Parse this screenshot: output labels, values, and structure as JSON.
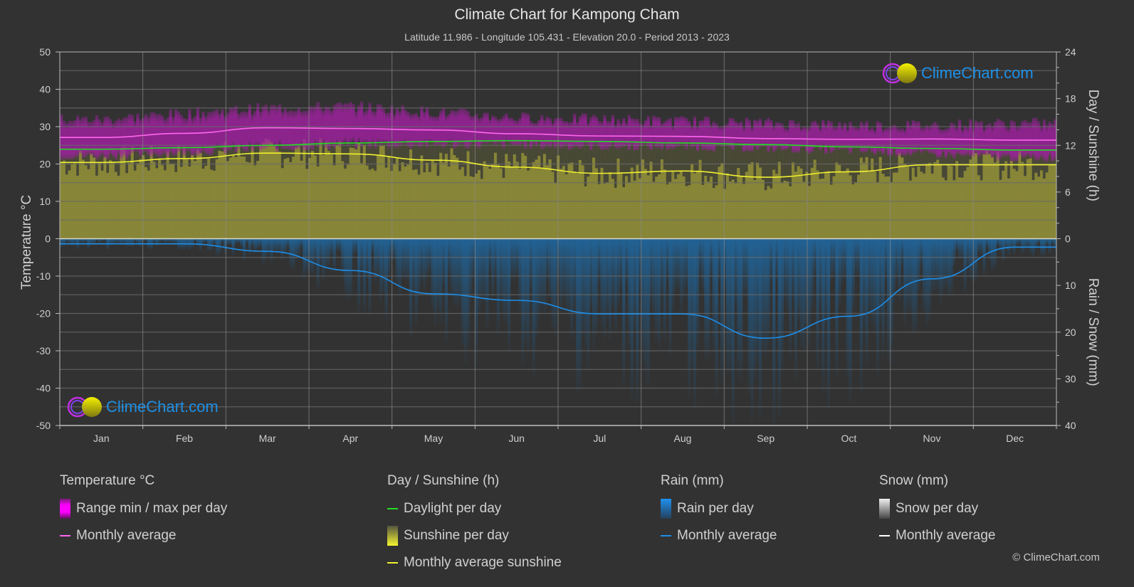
{
  "header": {
    "title": "Climate Chart for Kampong Cham",
    "subtitle": "Latitude 11.986 - Longitude 105.431 - Elevation 20.0 - Period 2013 - 2023"
  },
  "logo": {
    "text": "ClimeChart.com"
  },
  "copyright": "© ClimeChart.com",
  "colors": {
    "background": "#323232",
    "temp_range": "#a020a0",
    "temp_avg": "#ff66ee",
    "daylight": "#22dd22",
    "sunshine_fill": "#8c8a38",
    "sunshine_avg": "#f0f030",
    "rain_fill": "#1f5f91",
    "rain_avg": "#1e8ee8",
    "snow_avg": "#ffffff",
    "grid": "#6a6a6a",
    "logo_text": "#1e90e6"
  },
  "legend": {
    "temperature": {
      "title": "Temperature °C",
      "items": [
        "Range min / max per day",
        "Monthly average"
      ]
    },
    "sunshine": {
      "title": "Day / Sunshine (h)",
      "items": [
        "Daylight per day",
        "Sunshine per day",
        "Monthly average sunshine"
      ]
    },
    "rain": {
      "title": "Rain (mm)",
      "items": [
        "Rain per day",
        "Monthly average"
      ]
    },
    "snow": {
      "title": "Snow (mm)",
      "items": [
        "Snow per day",
        "Monthly average"
      ]
    }
  },
  "chart_data": {
    "type": "line",
    "title": "Climate Chart for Kampong Cham",
    "categories": [
      "Jan",
      "Feb",
      "Mar",
      "Apr",
      "May",
      "Jun",
      "Jul",
      "Aug",
      "Sep",
      "Oct",
      "Nov",
      "Dec"
    ],
    "axes": {
      "left": {
        "label": "Temperature °C",
        "range": [
          -50,
          50
        ],
        "ticks": [
          "50",
          "40",
          "30",
          "20",
          "10",
          "0",
          "-10",
          "-20",
          "-30",
          "-40",
          "-50"
        ]
      },
      "right_top": {
        "label": "Day / Sunshine (h)",
        "range": [
          0,
          24
        ],
        "ticks": [
          "24",
          "18",
          "12",
          "6",
          "0"
        ]
      },
      "right_bottom": {
        "label": "Rain / Snow (mm)",
        "range": [
          0,
          40
        ],
        "ticks": [
          "0",
          "10",
          "20",
          "30",
          "40"
        ]
      }
    },
    "grid": true,
    "legend_position": "bottom",
    "series": [
      {
        "name": "Temperature monthly average (°C)",
        "axis": "left",
        "values": [
          27.1,
          28.2,
          29.7,
          29.5,
          29.1,
          28.1,
          27.5,
          27.4,
          26.8,
          26.6,
          26.7,
          26.4
        ]
      },
      {
        "name": "Temperature daily max approx (°C)",
        "axis": "left",
        "values": [
          32,
          33.5,
          35,
          35.5,
          34,
          32.5,
          32,
          31.5,
          31,
          30.5,
          30.5,
          31
        ]
      },
      {
        "name": "Temperature daily min approx (°C)",
        "axis": "left",
        "values": [
          22,
          23,
          24,
          25,
          25,
          25,
          24.5,
          24.5,
          24,
          23.5,
          22.5,
          21.5
        ]
      },
      {
        "name": "Daylight per day (h)",
        "axis": "right_top",
        "values": [
          11.5,
          11.7,
          12.0,
          12.3,
          12.5,
          12.6,
          12.5,
          12.3,
          12.1,
          11.8,
          11.6,
          11.4
        ]
      },
      {
        "name": "Monthly average sunshine (h)",
        "axis": "right_top",
        "values": [
          9.8,
          10.3,
          11.0,
          10.9,
          10.1,
          9.2,
          8.4,
          8.7,
          7.9,
          8.6,
          9.5,
          9.5
        ]
      },
      {
        "name": "Rain monthly average (mm)",
        "axis": "right_bottom",
        "values": [
          1.1,
          1.1,
          2.7,
          6.8,
          11.8,
          13.2,
          16.1,
          16.1,
          21.3,
          16.6,
          8.6,
          1.8
        ]
      },
      {
        "name": "Snow monthly average (mm)",
        "axis": "right_bottom",
        "values": [
          0,
          0,
          0,
          0,
          0,
          0,
          0,
          0,
          0,
          0,
          0,
          0
        ]
      }
    ]
  }
}
